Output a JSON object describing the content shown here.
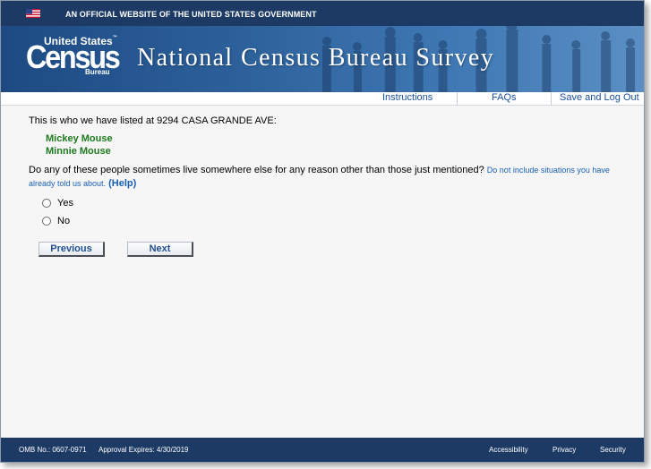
{
  "banner": {
    "text": "AN OFFICIAL WEBSITE OF THE UNITED STATES GOVERNMENT"
  },
  "logo": {
    "top": "United States",
    "tm": "™",
    "main": "Census",
    "bottom": "Bureau"
  },
  "header": {
    "title": "National Census Bureau Survey"
  },
  "nav": {
    "instructions": "Instructions",
    "faqs": "FAQs",
    "logout": "Save and Log Out"
  },
  "main": {
    "intro": "This is who we have listed at 9294 CASA GRANDE AVE:",
    "people": [
      "Mickey Mouse",
      "Minnie Mouse"
    ],
    "question": "Do any of these people sometimes live somewhere else for any reason other than those just mentioned?",
    "hint": "Do not include situations you have already told us about.",
    "help": "(Help)",
    "options": [
      "Yes",
      "No"
    ],
    "buttons": {
      "previous": "Previous",
      "next": "Next"
    }
  },
  "footer": {
    "omb": "OMB No.: 0607-0971",
    "approval": "Approval Expires: 4/30/2019",
    "links": [
      "Accessibility",
      "Privacy",
      "Security"
    ]
  },
  "colors": {
    "banner_bg": "#1c3a63",
    "link": "#1a4f9a",
    "person_name": "#1f7a1f",
    "hint": "#1a5fb4"
  }
}
